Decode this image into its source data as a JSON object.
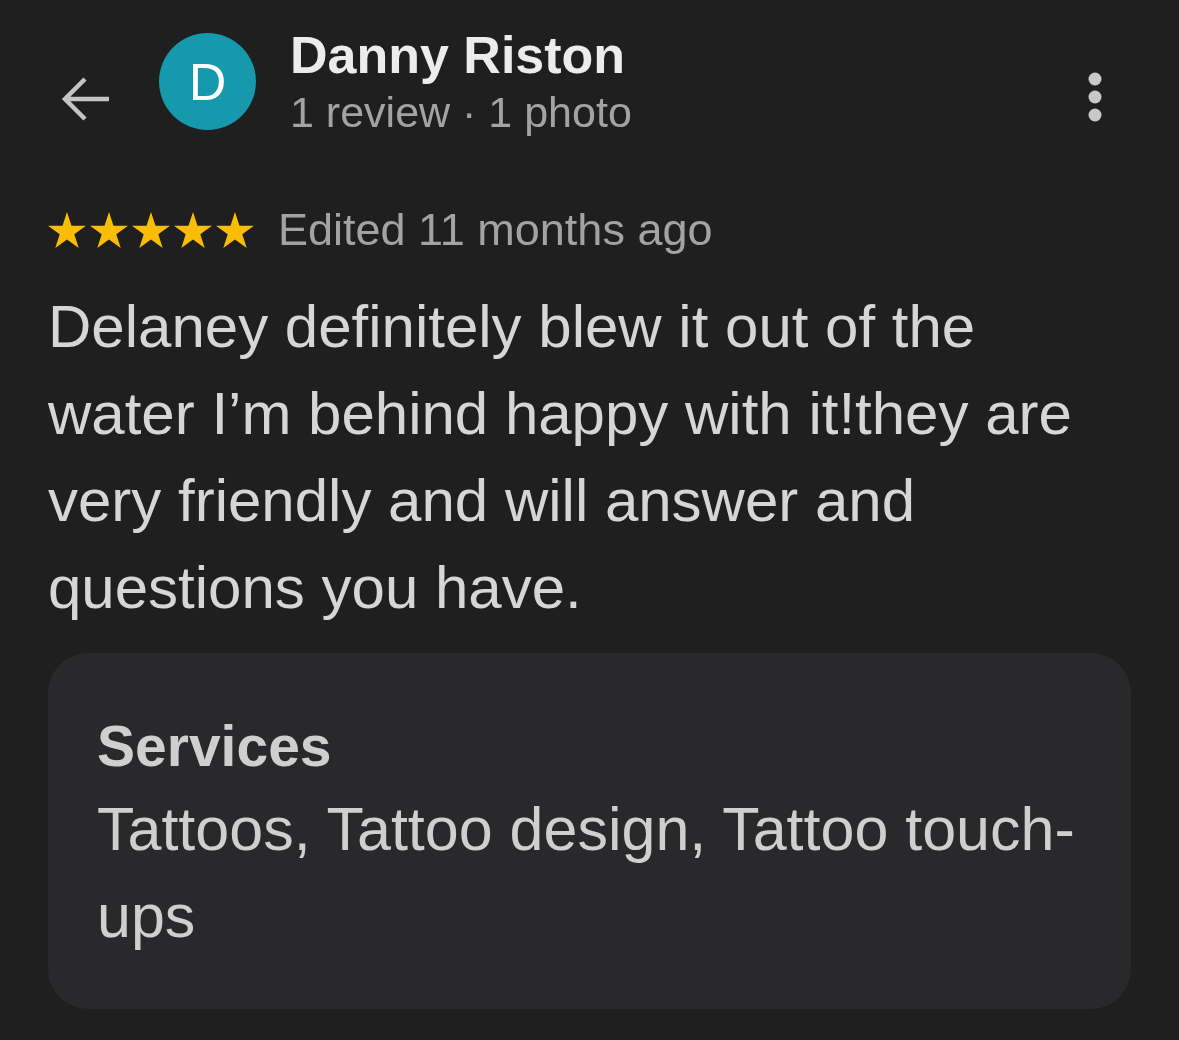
{
  "header": {
    "avatar_letter": "D",
    "name": "Danny Riston",
    "subtitle": "1 review · 1 photo"
  },
  "review": {
    "stars": 5,
    "edited": "Edited 11 months ago",
    "text": "Delaney definitely blew it out of the water I’m behind happy with it!they are very friendly and will answer and questions you have."
  },
  "services": {
    "title": "Services",
    "text": "Tattoos, Tattoo design, Tattoo touch-ups"
  }
}
